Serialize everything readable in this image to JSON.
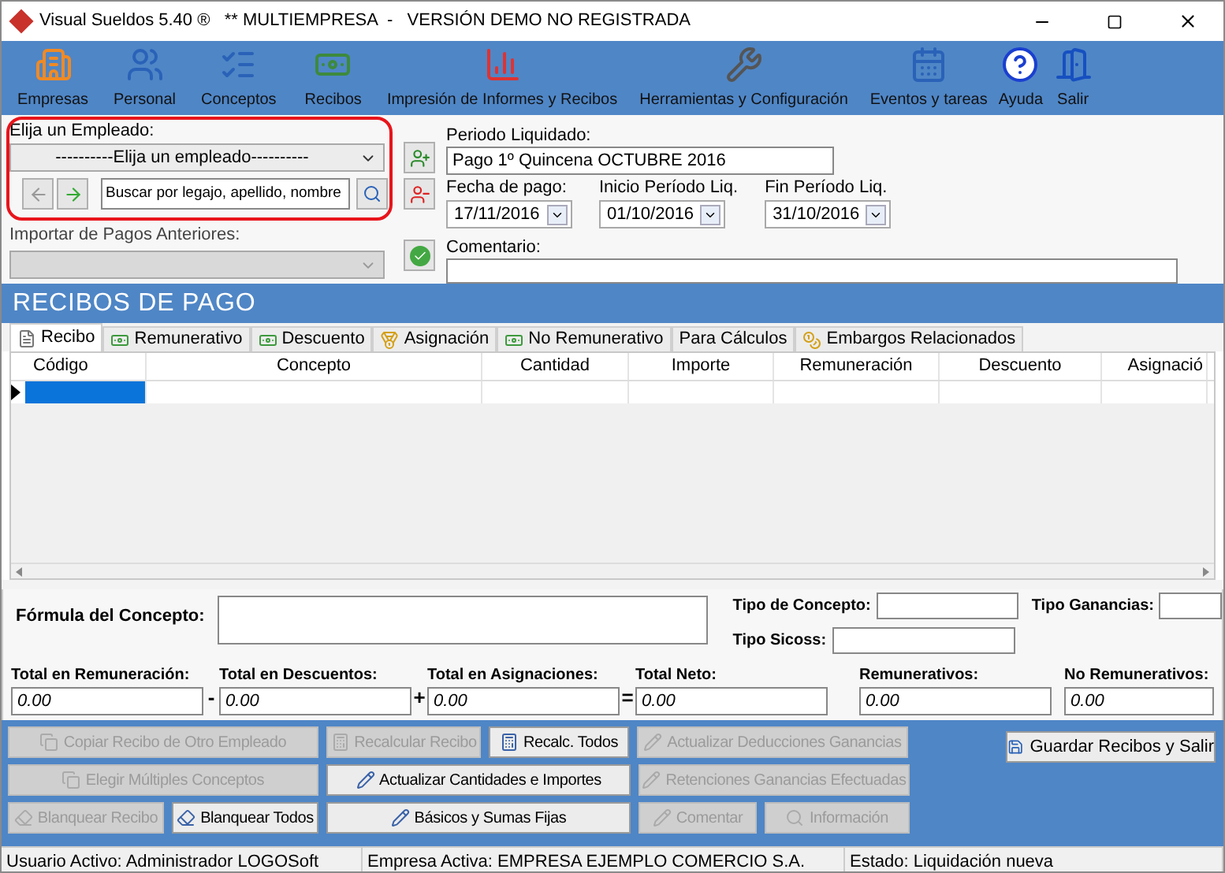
{
  "window": {
    "title": "Visual Sueldos 5.40 ®   ** MULTIEMPRESA  -   VERSIÓN DEMO NO REGISTRADA"
  },
  "toolbar": [
    {
      "label": "Empresas"
    },
    {
      "label": "Personal"
    },
    {
      "label": "Conceptos"
    },
    {
      "label": "Recibos"
    },
    {
      "label": "Impresión de Informes y Recibos"
    },
    {
      "label": "Herramientas y Configuración"
    },
    {
      "label": "Eventos y tareas"
    },
    {
      "label": "Ayuda"
    },
    {
      "label": "Salir"
    }
  ],
  "employee": {
    "label": "Elija un Empleado:",
    "select_value": "----------Elija un empleado----------",
    "search_value": "Buscar por legajo, apellido, nombre",
    "import_label": "Importar de Pagos Anteriores:",
    "import_disabled": true
  },
  "period": {
    "label": "Periodo Liquidado:",
    "value": "Pago 1º Quincena OCTUBRE 2016",
    "dates": [
      {
        "label": "Fecha de pago:",
        "value": "17/11/2016"
      },
      {
        "label": "Inicio Período Liq.",
        "value": "01/10/2016"
      },
      {
        "label": "Fin Período Liq.",
        "value": "31/10/2016"
      }
    ],
    "comment_label": "Comentario:"
  },
  "section_title": "RECIBOS DE PAGO",
  "tabs": [
    {
      "label": "Recibo",
      "selected": true
    },
    {
      "label": "Remunerativo",
      "selected": false
    },
    {
      "label": "Descuento",
      "selected": false
    },
    {
      "label": "Asignación",
      "selected": false
    },
    {
      "label": "No Remunerativo",
      "selected": false
    },
    {
      "label": "Para Cálculos",
      "selected": false
    },
    {
      "label": "Embargos Relacionados",
      "selected": false
    }
  ],
  "table": {
    "columns": [
      "Código",
      "Concepto",
      "Cantidad",
      "Importe",
      "Remuneración",
      "Descuento",
      "Asignació"
    ],
    "rows": [
      {
        "selected": true
      }
    ]
  },
  "details": {
    "formula_label": "Fórmula del Concepto:",
    "tipo_concepto_label": "Tipo de Concepto:",
    "tipo_ganancias_label": "Tipo Ganancias:",
    "tipo_sicoss_label": "Tipo Sicoss:"
  },
  "totals": [
    {
      "label": "Total en Remuneración:",
      "value": "0.00"
    },
    {
      "label": "Total en Descuentos:",
      "value": "0.00",
      "operator": "-"
    },
    {
      "label": "Total en Asignaciones:",
      "value": "0.00",
      "operator": "+"
    },
    {
      "label": "Total Neto:",
      "value": "0.00",
      "operator": "="
    },
    {
      "label": "Remunerativos:",
      "value": "0.00"
    },
    {
      "label": "No Remunerativos:",
      "value": "0.00"
    }
  ],
  "buttons": [
    [
      {
        "label": "Copiar Recibo de Otro Empleado",
        "disabled": true
      },
      {
        "label": "Recalcular Recibo",
        "disabled": true
      },
      {
        "label": "Recalc. Todos",
        "disabled": false
      },
      {
        "label": "Actualizar Deducciones Ganancias",
        "disabled": true
      }
    ],
    [
      {
        "label": "Elegir Múltiples Conceptos",
        "disabled": true
      },
      {
        "label": "Actualizar Cantidades e Importes",
        "disabled": false
      },
      {
        "label": "Retenciones  Ganancias Efectuadas",
        "disabled": true
      }
    ],
    [
      {
        "label": "Blanquear Recibo",
        "disabled": true
      },
      {
        "label": "Blanquear Todos",
        "disabled": false
      },
      {
        "label": "Básicos y Sumas Fijas",
        "disabled": false
      },
      {
        "label": "Comentar",
        "disabled": true
      },
      {
        "label": "Información",
        "disabled": true
      }
    ]
  ],
  "save_button": {
    "label": "Guardar Recibos y Salir",
    "disabled": false
  },
  "status_bar": [
    "Usuario Activo: Administrador LOGOSoft",
    "Empresa Activa: EMPRESA EJEMPLO COMERCIO S.A.",
    "Estado: Liquidación nueva"
  ]
}
